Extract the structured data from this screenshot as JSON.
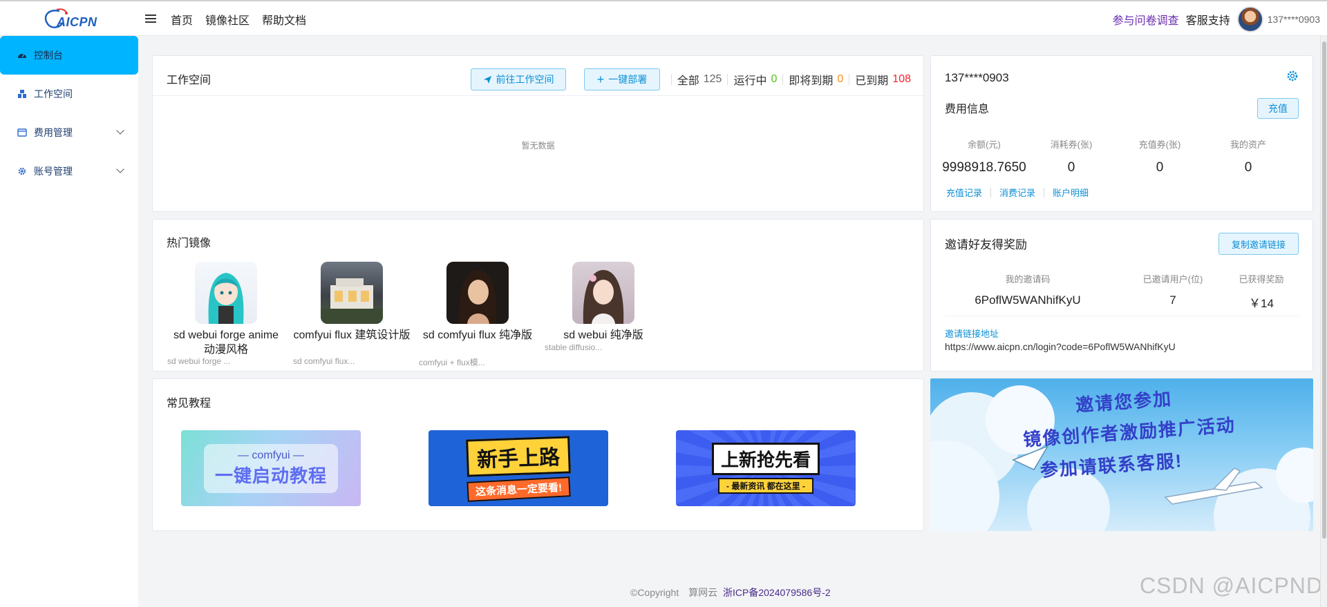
{
  "app": {
    "logo_text": "AICPN"
  },
  "topnav": {
    "items": [
      "首页",
      "镜像社区",
      "帮助文档"
    ],
    "survey": "参与问卷调查",
    "support": "客服支持",
    "user": "137****0903"
  },
  "sidebar": {
    "items": [
      {
        "label": "控制台",
        "icon": "dashboard-icon",
        "active": true
      },
      {
        "label": "工作空间",
        "icon": "workspace-icon"
      },
      {
        "label": "费用管理",
        "icon": "billing-icon",
        "expandable": true
      },
      {
        "label": "账号管理",
        "icon": "gear-icon",
        "expandable": true
      }
    ]
  },
  "workspace": {
    "title": "工作空间",
    "goto_button": "前往工作空间",
    "deploy_button": "一键部署",
    "stats": [
      {
        "label": "全部",
        "value": "125",
        "color": "#666666"
      },
      {
        "label": "运行中",
        "value": "0",
        "color": "#52c41a"
      },
      {
        "label": "即将到期",
        "value": "0",
        "color": "#fa8c16"
      },
      {
        "label": "已到期",
        "value": "108",
        "color": "#f5222d"
      }
    ],
    "empty_text": "暂无数据"
  },
  "account": {
    "user": "137****0903",
    "section": "费用信息",
    "recharge_button": "充值",
    "stats": [
      {
        "label": "余额(元)",
        "value": "9998918.7650"
      },
      {
        "label": "消耗券(张)",
        "value": "0"
      },
      {
        "label": "充值券(张)",
        "value": "0"
      },
      {
        "label": "我的资产",
        "value": "0"
      }
    ],
    "links": [
      "充值记录",
      "消费记录",
      "账户明细"
    ]
  },
  "hot_images": {
    "title": "热门镜像",
    "items": [
      {
        "name": "sd webui forge anime 动漫风格",
        "sub": "sd webui forge ..."
      },
      {
        "name": "comfyui flux 建筑设计版",
        "sub": "sd comfyui flux..."
      },
      {
        "name": "sd comfyui flux 纯净版",
        "sub": "comfyui + flux模..."
      },
      {
        "name": "sd webui 纯净版",
        "sub": "stable diffusio..."
      }
    ]
  },
  "invite": {
    "title": "邀请好友得奖励",
    "copy_button": "复制邀请链接",
    "headers": [
      "我的邀请码",
      "已邀请用户(位)",
      "已获得奖励"
    ],
    "values": [
      "6PoflW5WANhifKyU",
      "7",
      "￥14"
    ],
    "link_label": "邀请链接地址",
    "link_url": "https://www.aicpn.cn/login?code=6PoflW5WANhifKyU"
  },
  "tutorials": {
    "title": "常见教程",
    "banners": [
      {
        "line1": "— comfyui —",
        "line2": "一键启动教程"
      },
      {
        "line1": "新手上路",
        "line2": "这条消息一定要看!"
      },
      {
        "line1": "上新抢先看",
        "line2": "- 最新资讯 都在这里 -"
      }
    ]
  },
  "promo": {
    "lines": [
      "邀请您参加",
      "镜像创作者激励推广活动",
      "参加请联系客服!"
    ]
  },
  "footer": {
    "copyright": "©Copyright",
    "company": "算网云",
    "icp": "浙ICP备2024079586号-2"
  },
  "watermark": "CSDN @AICPND"
}
